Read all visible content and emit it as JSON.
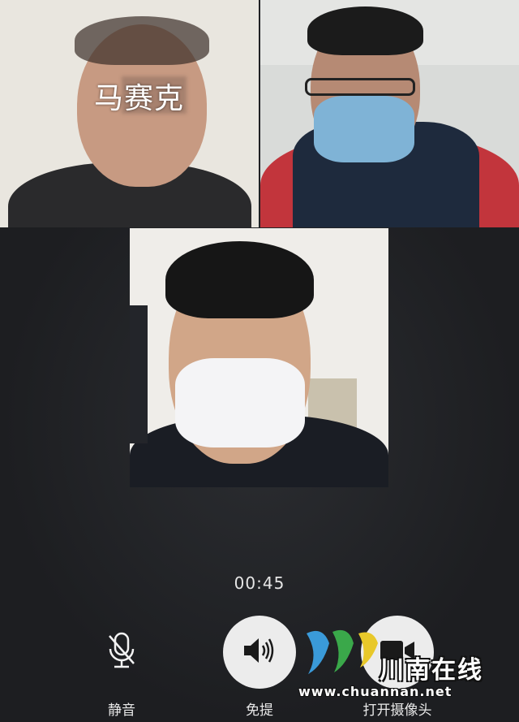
{
  "participants": [
    {
      "name_label": "马赛克"
    },
    {},
    {}
  ],
  "call": {
    "duration": "00:45"
  },
  "controls": {
    "mute_label": "静音",
    "speaker_label": "免提",
    "camera_label": "打开摄像头"
  },
  "icons": {
    "mute": "microphone-off-icon",
    "speaker": "speaker-icon",
    "camera": "camera-icon"
  },
  "watermark": {
    "site_name": "川南在线",
    "url": "www.chuannan.net"
  },
  "colors": {
    "background": "#1f2023",
    "button_fill": "#ececec",
    "text": "#e8e8e8"
  }
}
